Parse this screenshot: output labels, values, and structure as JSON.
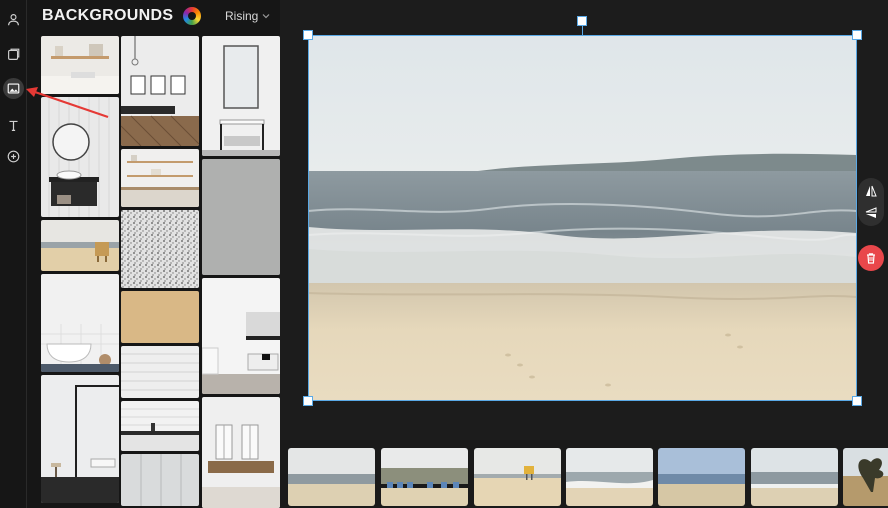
{
  "panel": {
    "title": "BACKGROUNDS",
    "sort_label": "Rising"
  },
  "rail": {
    "items": [
      {
        "name": "user-icon",
        "active": false
      },
      {
        "name": "layers-icon",
        "active": false
      },
      {
        "name": "image-icon",
        "active": true
      },
      {
        "name": "text-icon",
        "active": false
      },
      {
        "name": "add-icon",
        "active": false
      }
    ]
  },
  "colors": {
    "accent": "#5aa9e6",
    "delete": "#e9474b",
    "annotation_arrow": "#e53935"
  },
  "gallery": [
    {
      "name": "bathroom-shelf-thumb",
      "style": "bathroom-light"
    },
    {
      "name": "bathroom-mirror-thumb",
      "style": "bathroom-white"
    },
    {
      "name": "beach-chair-thumb",
      "style": "beach"
    },
    {
      "name": "bathtub-thumb",
      "style": "bathroom-white"
    },
    {
      "name": "shower-black-frame-thumb",
      "style": "bathroom-dark"
    },
    {
      "name": "gallery-wall-thumb",
      "style": "interior"
    },
    {
      "name": "kitchen-shelf-thumb",
      "style": "kitchen"
    },
    {
      "name": "terrazzo-texture-thumb",
      "style": "texture-speckle"
    },
    {
      "name": "sand-texture-thumb",
      "style": "texture-sand"
    },
    {
      "name": "white-tiles-thumb",
      "style": "texture-tile"
    },
    {
      "name": "kitchen-counter-thumb",
      "style": "kitchen"
    },
    {
      "name": "cabinet-doors-thumb",
      "style": "cabinet"
    },
    {
      "name": "bathroom-vanity-thumb",
      "style": "bathroom-light"
    },
    {
      "name": "concrete-texture-thumb",
      "style": "texture-concrete"
    },
    {
      "name": "bathroom-sink-thumb",
      "style": "bathroom-white"
    },
    {
      "name": "bright-room-thumb",
      "style": "interior"
    }
  ],
  "canvas": {
    "image": "beach-scene"
  },
  "filmstrip": [
    {
      "name": "film-beach-1"
    },
    {
      "name": "film-beach-huts"
    },
    {
      "name": "film-beach-lifeguard"
    },
    {
      "name": "film-beach-waves"
    },
    {
      "name": "film-beach-blue-sky"
    },
    {
      "name": "film-beach-calm"
    },
    {
      "name": "film-beach-tree"
    }
  ]
}
